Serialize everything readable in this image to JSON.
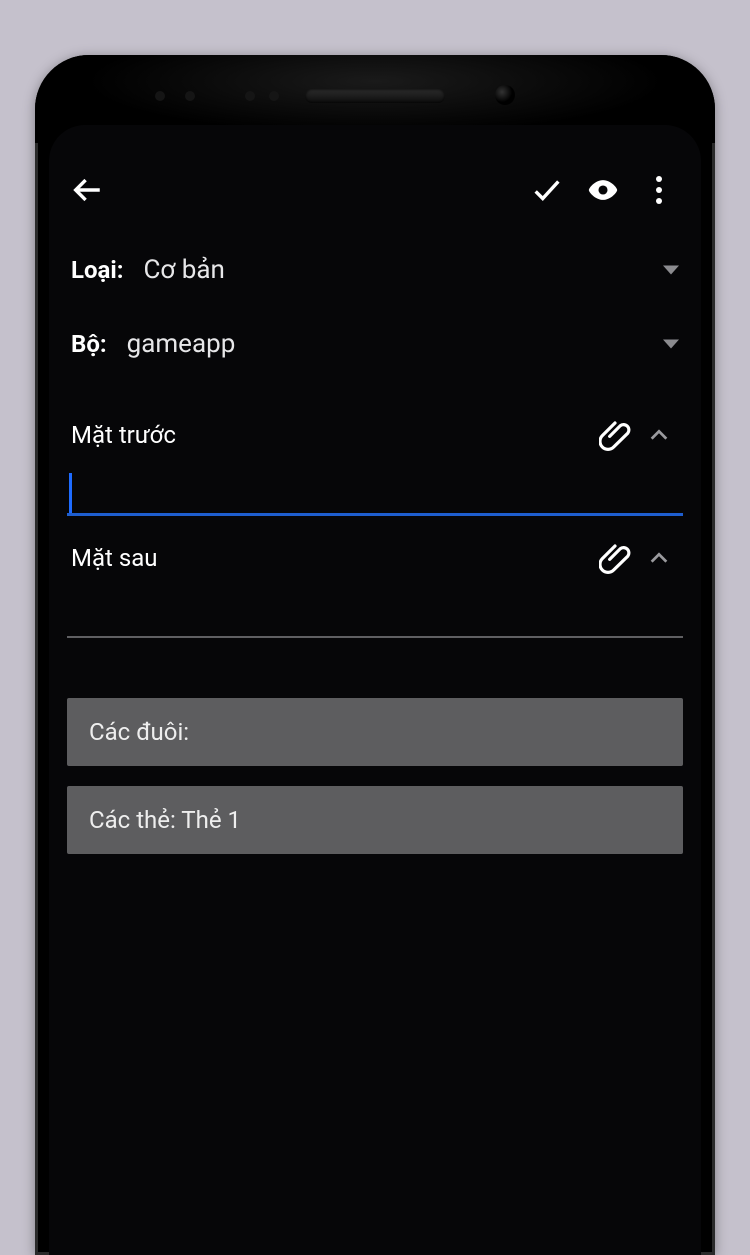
{
  "selectors": {
    "type_label": "Loại:",
    "type_value": "Cơ bản",
    "deck_label": "Bộ:",
    "deck_value": "gameapp"
  },
  "fields": {
    "front_label": "Mặt trước",
    "front_value": "",
    "back_label": "Mặt sau",
    "back_value": ""
  },
  "footer": {
    "tags_label": "Các đuôi:",
    "cards_label": "Các thẻ: Thẻ 1"
  }
}
